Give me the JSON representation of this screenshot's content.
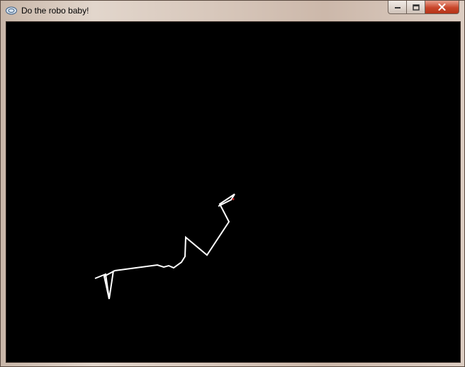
{
  "window": {
    "title": "Do the robo baby!"
  },
  "icons": {
    "app": "app-icon",
    "minimize": "minimize-icon",
    "maximize": "maximize-icon",
    "close": "close-icon"
  },
  "colors": {
    "canvas_background": "#000000",
    "path_stroke": "#ffffff",
    "marker": "#cc2222"
  }
}
